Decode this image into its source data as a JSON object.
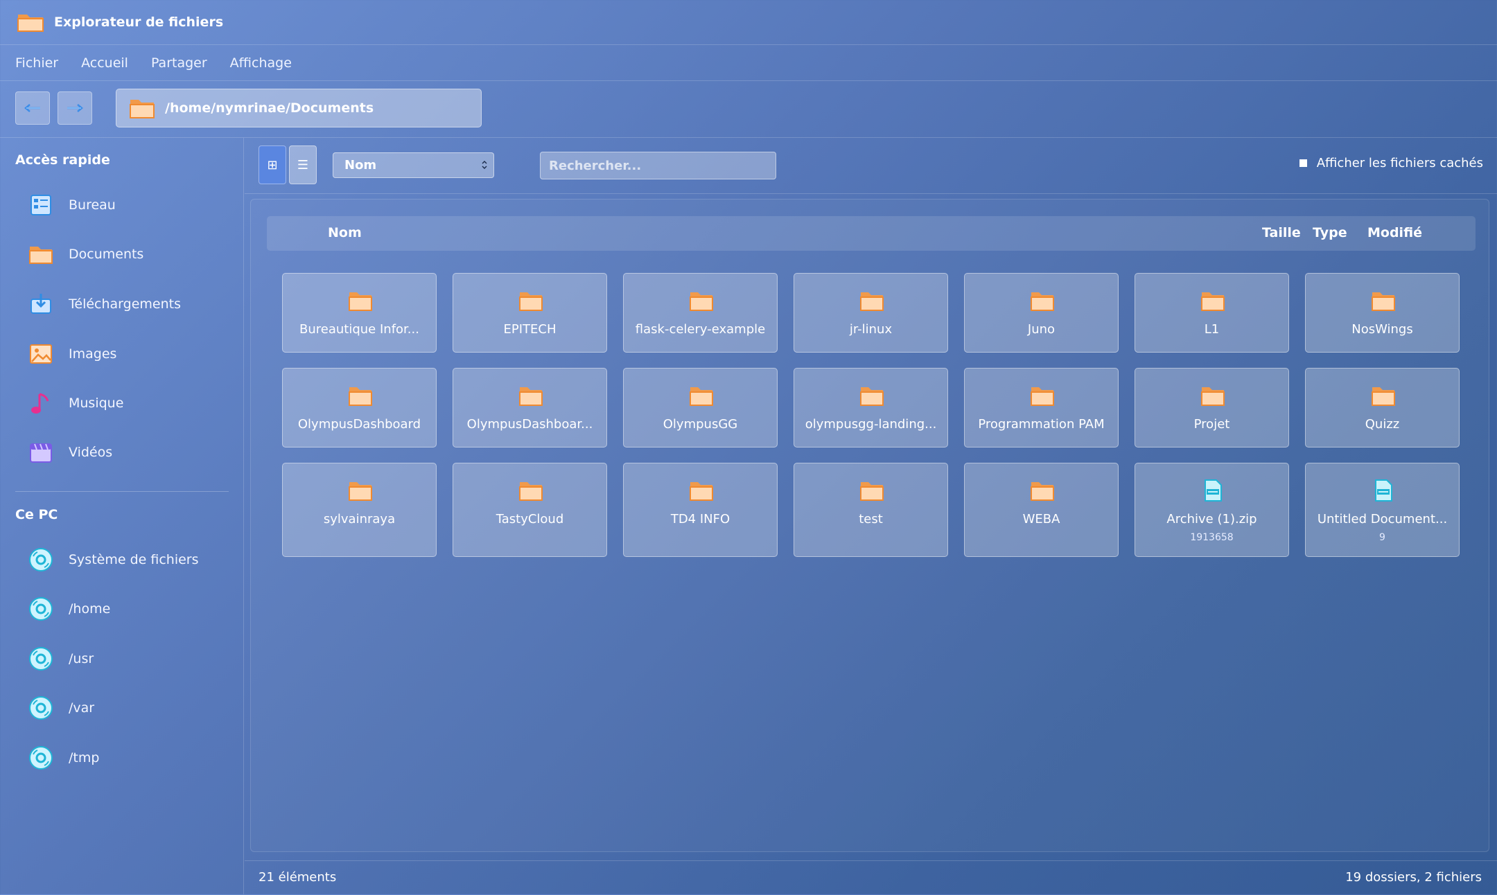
{
  "window": {
    "title": "Explorateur de fichiers",
    "app_icon": "folder-icon"
  },
  "menu": [
    "Fichier",
    "Accueil",
    "Partager",
    "Affichage"
  ],
  "nav": {
    "back_icon": "arrow-left-icon",
    "forward_icon": "arrow-right-icon",
    "path": "/home/nymrinae/Documents"
  },
  "sidebar": {
    "quick_access_title": "Accès rapide",
    "quick_access": [
      {
        "label": "Bureau",
        "icon": "desktop-icon"
      },
      {
        "label": "Documents",
        "icon": "folder-icon"
      },
      {
        "label": "Téléchargements",
        "icon": "download-icon"
      },
      {
        "label": "Images",
        "icon": "image-icon"
      },
      {
        "label": "Musique",
        "icon": "music-icon"
      },
      {
        "label": "Vidéos",
        "icon": "video-icon"
      }
    ],
    "pc_title": "Ce PC",
    "pc": [
      {
        "label": "Système de fichiers",
        "icon": "disk-icon"
      },
      {
        "label": "/home",
        "icon": "disk-icon"
      },
      {
        "label": "/usr",
        "icon": "disk-icon"
      },
      {
        "label": "/var",
        "icon": "disk-icon"
      },
      {
        "label": "/tmp",
        "icon": "disk-icon"
      }
    ]
  },
  "toolbar": {
    "grid_view_icon": "⊞",
    "list_view_icon": "☰",
    "sort_value": "Nom",
    "search_placeholder": "Rechercher...",
    "show_hidden_label": "Afficher les fichiers cachés"
  },
  "columns": {
    "name": "Nom",
    "size": "Taille",
    "type": "Type",
    "modified": "Modifié"
  },
  "items": [
    {
      "name": "Bureautique Infor...",
      "kind": "folder"
    },
    {
      "name": "EPITECH",
      "kind": "folder"
    },
    {
      "name": "flask-celery-example",
      "kind": "folder"
    },
    {
      "name": "jr-linux",
      "kind": "folder"
    },
    {
      "name": "Juno",
      "kind": "folder"
    },
    {
      "name": "L1",
      "kind": "folder"
    },
    {
      "name": "NosWings",
      "kind": "folder"
    },
    {
      "name": "OlympusDashboard",
      "kind": "folder"
    },
    {
      "name": "OlympusDashboar...",
      "kind": "folder"
    },
    {
      "name": "OlympusGG",
      "kind": "folder"
    },
    {
      "name": "olympusgg-landing...",
      "kind": "folder"
    },
    {
      "name": "Programmation PAM",
      "kind": "folder"
    },
    {
      "name": "Projet",
      "kind": "folder"
    },
    {
      "name": "Quizz",
      "kind": "folder"
    },
    {
      "name": "sylvainraya",
      "kind": "folder"
    },
    {
      "name": "TastyCloud",
      "kind": "folder"
    },
    {
      "name": "TD4 INFO",
      "kind": "folder"
    },
    {
      "name": "test",
      "kind": "folder"
    },
    {
      "name": "WEBA",
      "kind": "folder"
    },
    {
      "name": "Archive (1).zip",
      "kind": "file",
      "size": "1913658"
    },
    {
      "name": "Untitled Document...",
      "kind": "file",
      "size": "9"
    }
  ],
  "status": {
    "count": "21 éléments",
    "summary": "19 dossiers, 2 fichiers"
  },
  "colors": {
    "folder": "#f4a04a",
    "file": "#29c4d8",
    "accent": "#5a86e0"
  }
}
